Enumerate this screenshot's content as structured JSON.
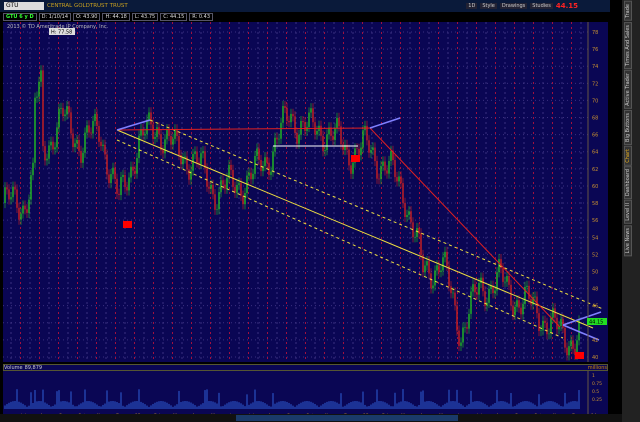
{
  "symbol": "GTU",
  "description": "CENTRAL GOLDTRUST TRUST",
  "toolbar": {
    "style": "Style",
    "drawings": "Drawings",
    "studies": "Studies",
    "period": "1D",
    "last": "44.15"
  },
  "info": {
    "agg": "GTU 6 y D",
    "date": "D: 1/10/14",
    "open": "O: 43.90",
    "high": "H: 44.18",
    "low": "L: 43.75",
    "close": "C: 44.15",
    "range": "R: 0.43"
  },
  "copyright": "2013 © TD Ameritrade IP Company, Inc.",
  "high_label": "H: 77.58",
  "price_tag": "44.15",
  "volume": {
    "label": "Volume",
    "value": "89,879",
    "unit": "millions",
    "ticks": [
      "1",
      "0.75",
      "0.5",
      "0.25"
    ]
  },
  "side_tabs": [
    "Trade",
    "Times And Sales",
    "Active Trader",
    "Big Buttons",
    "Chart",
    "Dashboard",
    "Level II",
    "Live News"
  ],
  "colors": {
    "bg": "#0a0654",
    "up": "#22c022",
    "down": "#d02020",
    "channel": "#f0e040",
    "red_line": "#e02020",
    "pitch": "#8080ff"
  },
  "chart_data": {
    "type": "candlestick",
    "ylim": [
      40,
      78
    ],
    "yticks": [
      78,
      76,
      74,
      72,
      70,
      68,
      66,
      64,
      62,
      60,
      58,
      56,
      54,
      52,
      50,
      48,
      46,
      44,
      42,
      40
    ],
    "x_labels": [
      "Jul",
      "Aug",
      "Sep",
      "Oct",
      "Nov",
      "Dec",
      "12",
      "Feb",
      "Mar",
      "Apr",
      "May",
      "Jun",
      "Jul",
      "Aug",
      "Sep",
      "Oct",
      "Nov",
      "Dec",
      "13",
      "Feb",
      "Mar",
      "Apr",
      "May",
      "Jun",
      "Jul",
      "Aug",
      "Sep",
      "Oct",
      "Nov",
      "Dec",
      "14",
      "Feb"
    ],
    "monthly_close": [
      58,
      64,
      68,
      65,
      66.5,
      58,
      65,
      67,
      64,
      63,
      59.5,
      60,
      61,
      64,
      68.3,
      66.5,
      66.5,
      64,
      64.5,
      62.4,
      59.5,
      50,
      51,
      43,
      48,
      49,
      46.7,
      45.5,
      43,
      42,
      44.15
    ]
  }
}
